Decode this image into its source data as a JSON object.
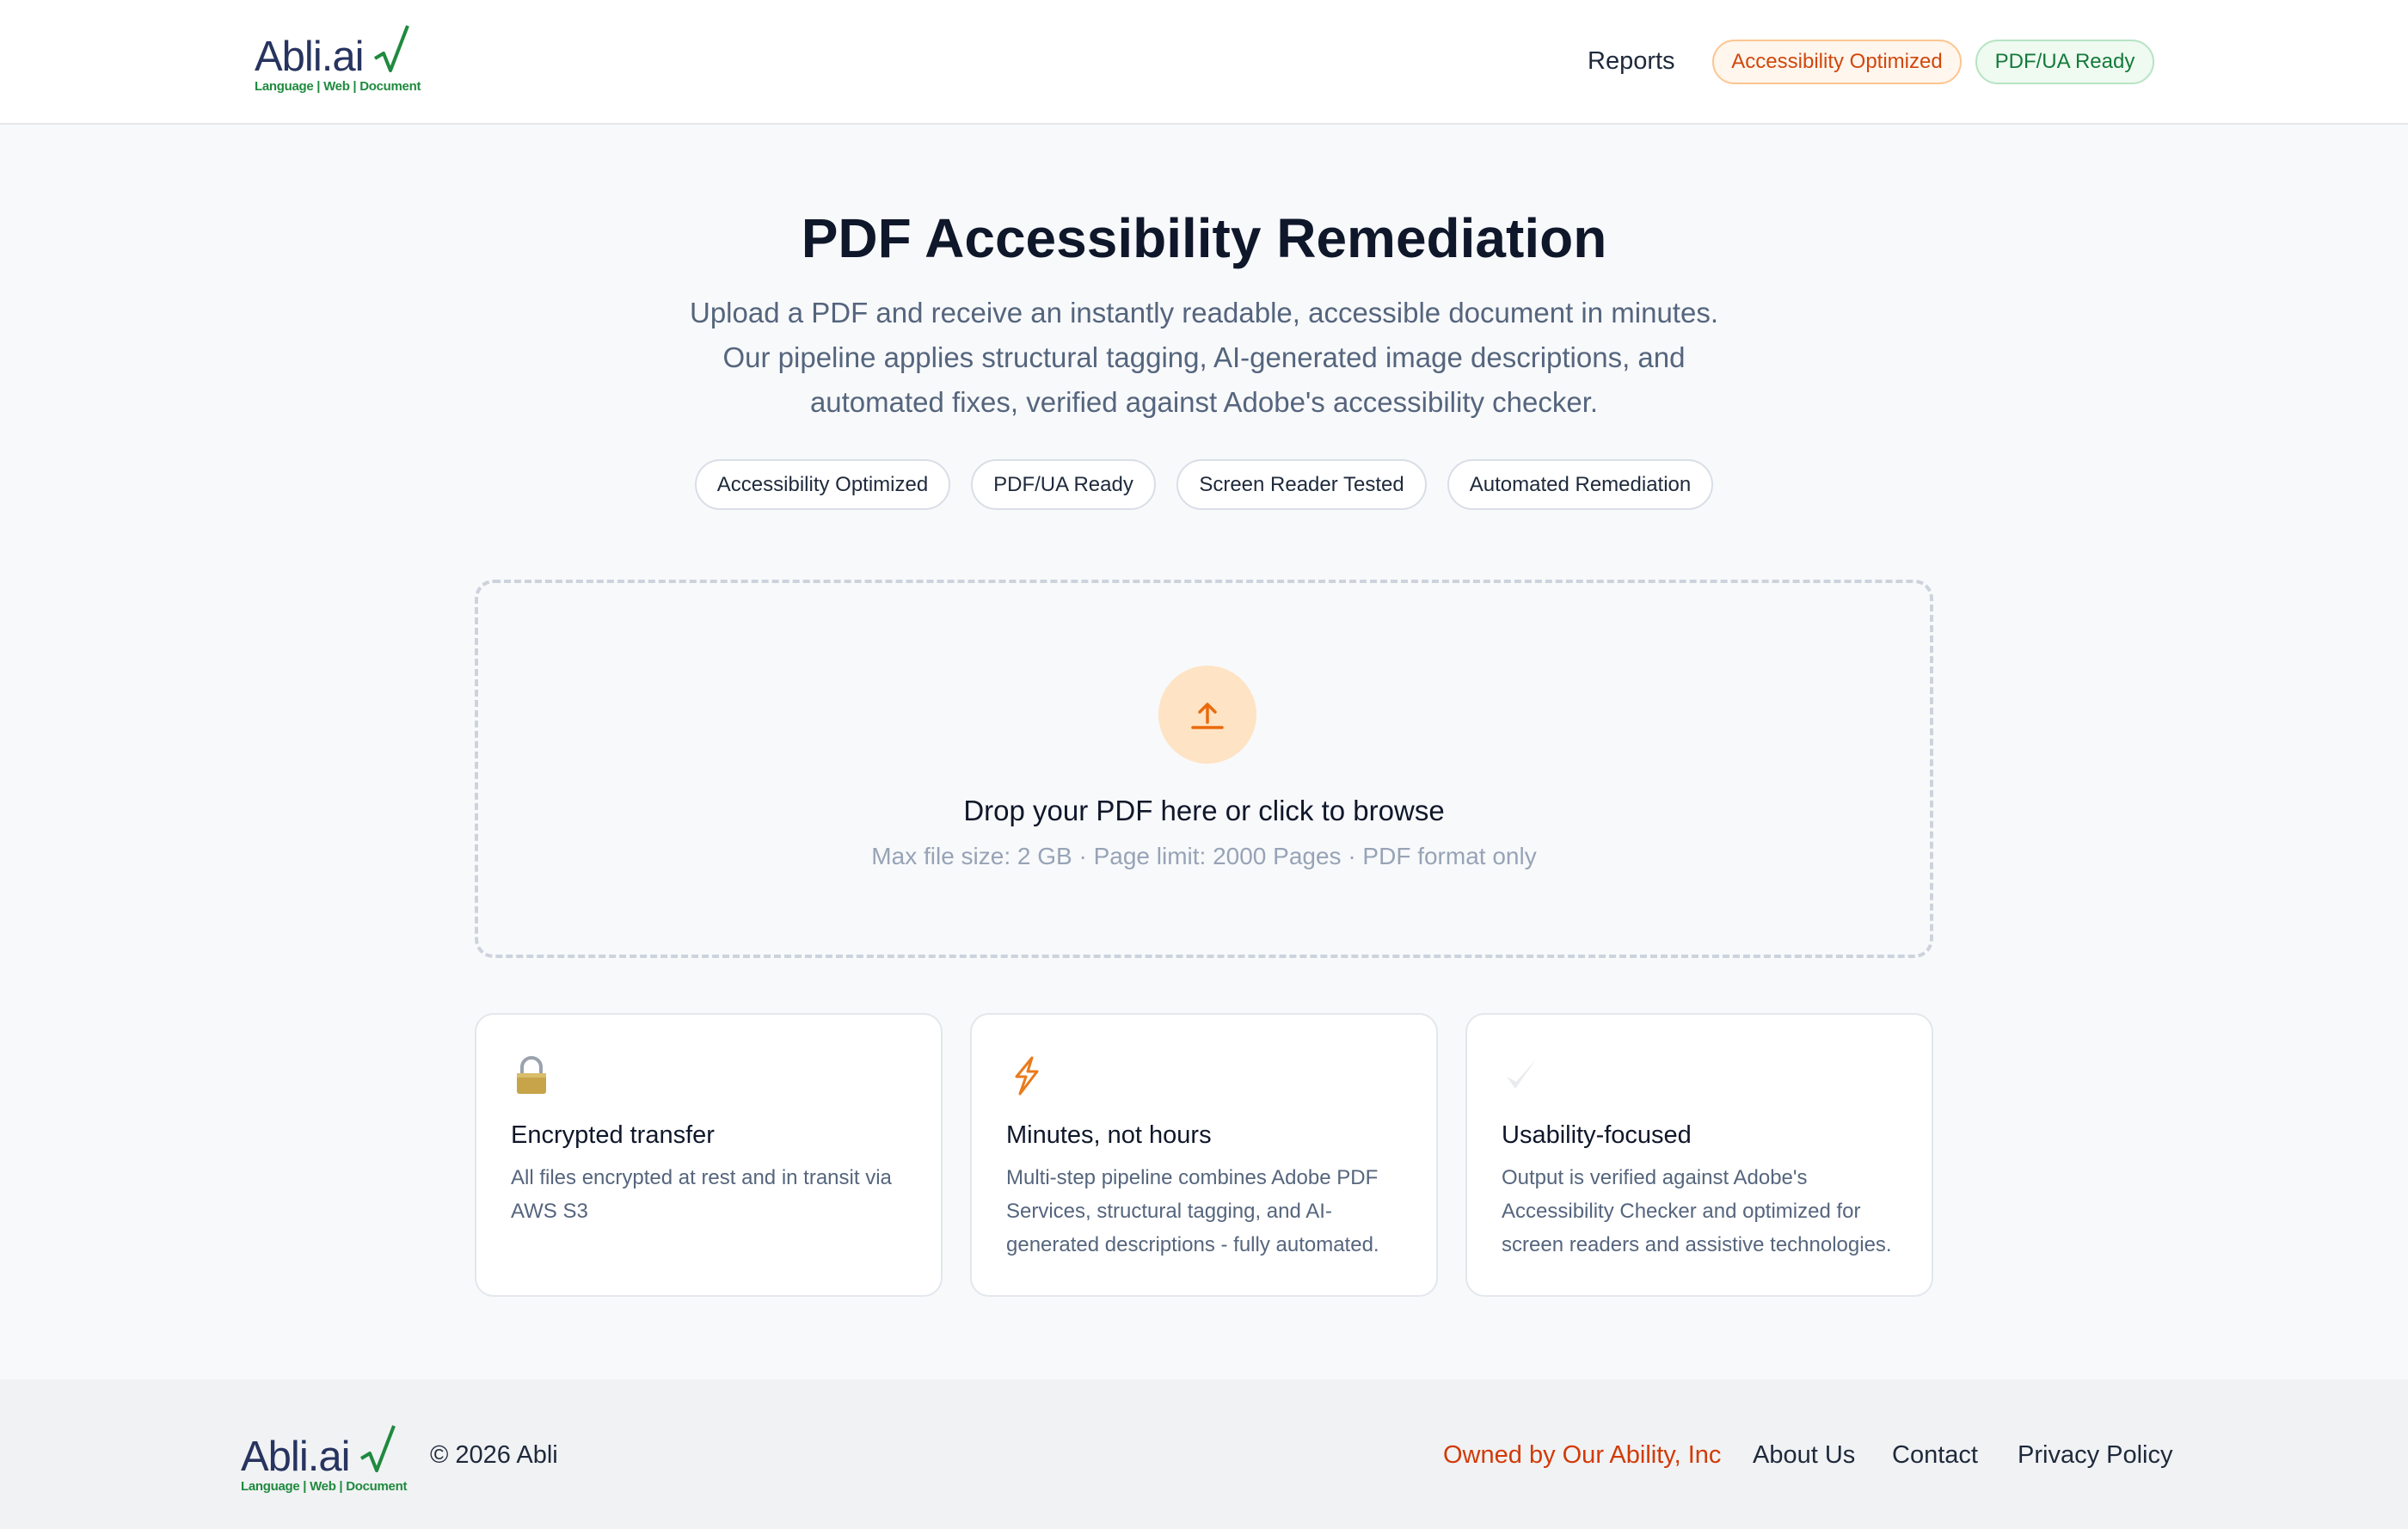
{
  "header": {
    "logo": {
      "name": "Abli.ai",
      "tagline": "Language | Web | Document"
    },
    "nav_reports": "Reports",
    "badges": [
      "Accessibility Optimized",
      "PDF/UA Ready"
    ]
  },
  "hero": {
    "title": "PDF Accessibility Remediation",
    "subtitle": "Upload a PDF and receive an instantly readable, accessible document in minutes. Our pipeline applies structural tagging, AI-generated image descriptions, and automated fixes, verified against Adobe's accessibility checker.",
    "chips": [
      "Accessibility Optimized",
      "PDF/UA Ready",
      "Screen Reader Tested",
      "Automated Remediation"
    ]
  },
  "upload": {
    "icon": "upload-arrow-icon",
    "title": "Drop your PDF here or click to browse",
    "hint": "Max file size: 2 GB · Page limit: 2000 Pages · PDF format only"
  },
  "features": [
    {
      "icon": "lock-icon",
      "title": "Encrypted transfer",
      "desc": "All files encrypted at rest and in transit via AWS S3"
    },
    {
      "icon": "lightning-icon",
      "title": "Minutes, not hours",
      "desc": "Multi-step pipeline combines Adobe PDF Services, structural tagging, and AI-generated descriptions - fully automated."
    },
    {
      "icon": "checkmark-icon",
      "title": "Usability-focused",
      "desc": "Output is verified against Adobe's Accessibility Checker and optimized for screen readers and assistive technologies."
    }
  ],
  "footer": {
    "logo": {
      "name": "Abli.ai",
      "tagline": "Language | Web | Document"
    },
    "copyright": "© 2026 Abli",
    "links": [
      "Owned by Our Ability, Inc",
      "About Us",
      "Contact",
      "Privacy Policy"
    ]
  },
  "colors": {
    "accent_orange": "#d23a06",
    "brand_green": "#1f8a3f",
    "brand_navy": "#27345f",
    "upload_circle": "#fee3c4"
  }
}
